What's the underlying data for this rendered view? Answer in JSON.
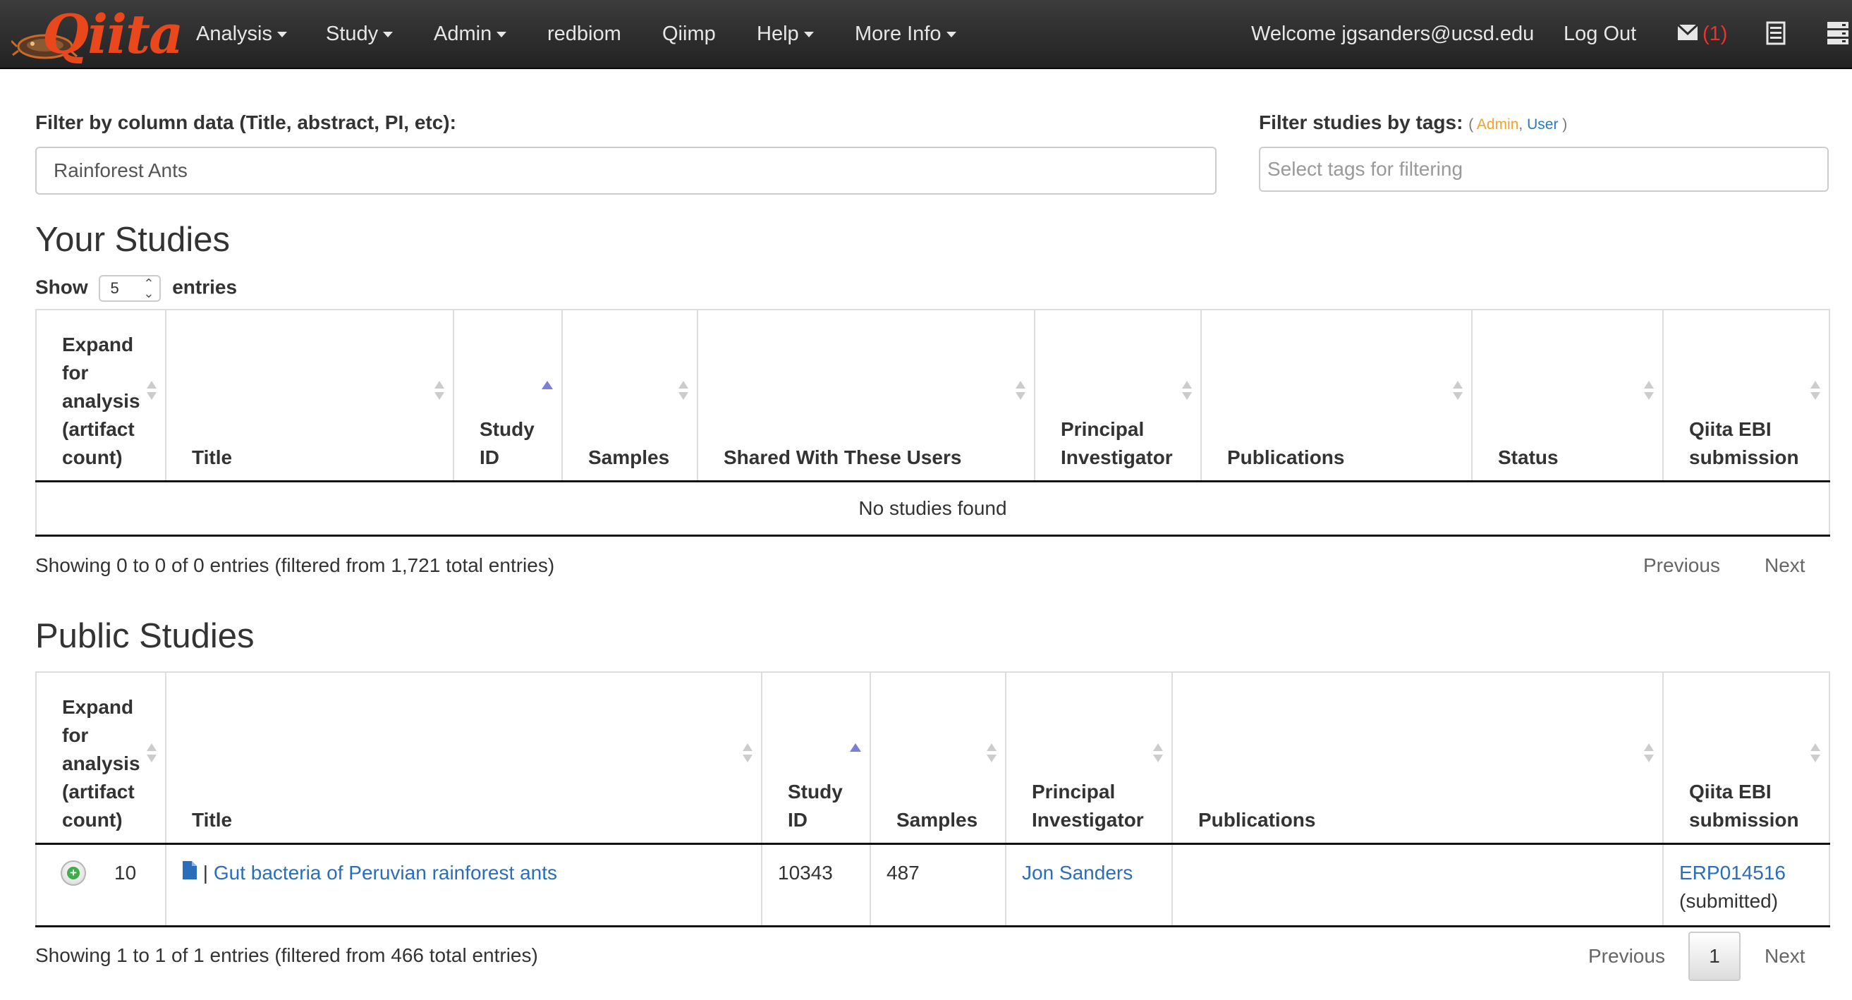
{
  "navbar": {
    "brand": "Qiita",
    "menu": [
      {
        "label": "Analysis",
        "has_caret": true
      },
      {
        "label": "Study",
        "has_caret": true
      },
      {
        "label": "Admin",
        "has_caret": true
      },
      {
        "label": "redbiom",
        "has_caret": false
      },
      {
        "label": "Qiimp",
        "has_caret": false
      },
      {
        "label": "Help",
        "has_caret": true
      },
      {
        "label": "More Info",
        "has_caret": true
      }
    ],
    "welcome": "Welcome jgsanders@ucsd.edu",
    "logout": "Log Out",
    "mail_count": "(1)",
    "icons": [
      "envelope-icon",
      "jobs-list-icon",
      "server-icon"
    ],
    "background_color": "#2b2b2b",
    "brand_color": "#e8481c"
  },
  "filters": {
    "column_label": "Filter by column data (Title, abstract, PI, etc):",
    "column_value": "Rainforest Ants",
    "tags_label": "Filter studies by tags:",
    "tags_legend_open": "(",
    "tags_legend_admin": "Admin",
    "tags_legend_sep": ",",
    "tags_legend_user": "User",
    "tags_legend_close": ")",
    "tags_placeholder": "Select tags for filtering",
    "admin_color": "#f0a22c",
    "user_color": "#2a7abd"
  },
  "your_studies": {
    "title": "Your Studies",
    "show_label": "Show",
    "page_size": "5",
    "entries_label": "entries",
    "columns": [
      "Expand for analysis (artifact count)",
      "Title",
      "Study ID",
      "Samples",
      "Shared With These Users",
      "Principal Investigator",
      "Publications",
      "Status",
      "Qiita EBI submission"
    ],
    "empty_message": "No studies found",
    "info": "Showing 0 to 0 of 0 entries (filtered from 1,721 total entries)",
    "previous": "Previous",
    "next": "Next"
  },
  "public_studies": {
    "title": "Public Studies",
    "columns": [
      "Expand for analysis (artifact count)",
      "Title",
      "Study ID",
      "Samples",
      "Principal Investigator",
      "Publications",
      "Qiita EBI submission"
    ],
    "rows": [
      {
        "artifact_count": "10",
        "title_separator": "|",
        "title": "Gut bacteria of Peruvian rainforest ants",
        "study_id": "10343",
        "samples": "487",
        "pi": "Jon Sanders",
        "publications": "",
        "ebi_accession": "ERP014516",
        "ebi_status": "(submitted)"
      }
    ],
    "info": "Showing 1 to 1 of 1 entries (filtered from 466 total entries)",
    "previous": "Previous",
    "current_page": "1",
    "next": "Next"
  },
  "colors": {
    "link": "#2a6ebb",
    "sort_active": "#7a7fd8",
    "expand_green": "#3fae48"
  }
}
